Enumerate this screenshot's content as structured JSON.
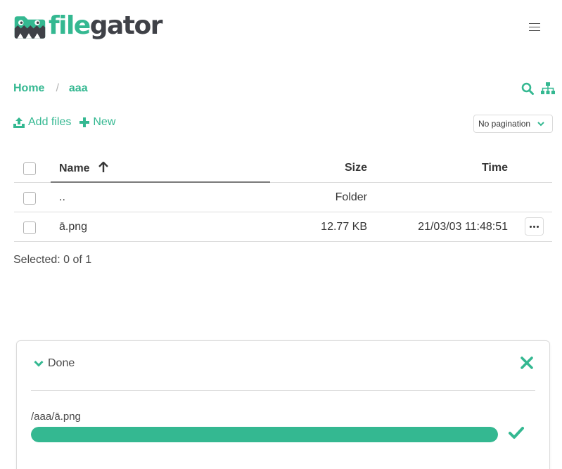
{
  "header": {
    "logo_part1": "file",
    "logo_part2": "gator",
    "menu_icon": "hamburger-icon"
  },
  "breadcrumb": {
    "items": [
      "Home",
      "aaa"
    ],
    "separator": "/"
  },
  "toolbar": {
    "add_files_label": "Add files",
    "new_label": "New",
    "pagination_value": "No pagination"
  },
  "table": {
    "columns": {
      "name": "Name",
      "size": "Size",
      "time": "Time"
    },
    "sort": "ascending",
    "rows": [
      {
        "name": "..",
        "size": "Folder",
        "time": ""
      },
      {
        "name": "ā.png",
        "size": "12.77 KB",
        "time": "21/03/03 11:48:51"
      }
    ]
  },
  "selection": {
    "text": "Selected: 0 of 1"
  },
  "upload": {
    "status_label": "Done",
    "file_path": "/aaa/ā.png",
    "progress_percent": 100
  },
  "colors": {
    "accent": "#34b891",
    "text": "#363636",
    "logo_dark": "#3f4147"
  }
}
